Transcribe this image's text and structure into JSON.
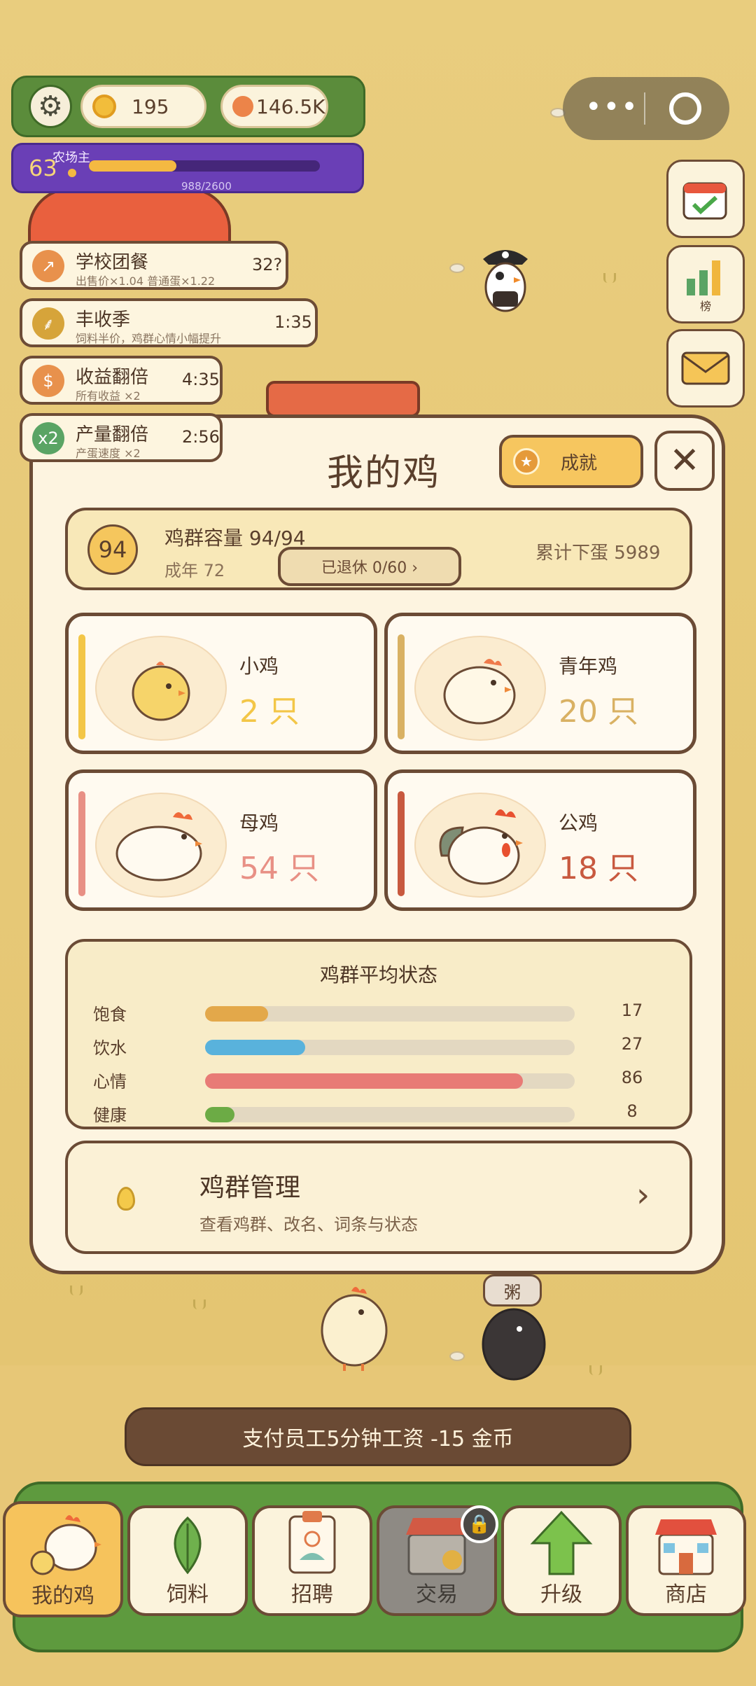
{
  "hud": {
    "coins": "195",
    "eggs": "146.5K",
    "level": "63",
    "level_title": "农场主",
    "xp_text": "988/2600",
    "xp_fraction": 0.38
  },
  "side_buttons": {
    "rank_label": "榜"
  },
  "events": [
    {
      "title": "学校团餐",
      "desc": "出售价×1.04 普通蛋×1.22",
      "time": "32?",
      "icon": "↗",
      "color": "#e8914c"
    },
    {
      "title": "丰收季",
      "desc": "饲料半价，鸡群心情小幅提升",
      "time": "1:35",
      "icon": "wheat-icon",
      "color": "#d6a43a"
    },
    {
      "title": "收益翻倍",
      "desc": "所有收益 ×2",
      "time": "4:35",
      "icon": "$",
      "color": "#e8914c"
    },
    {
      "title": "产量翻倍",
      "desc": "产蛋速度 ×2",
      "time": "2:56",
      "icon": "x2",
      "color": "#5aa464"
    }
  ],
  "modal": {
    "title": "我的鸡",
    "achievements_label": "成就",
    "capacity": {
      "badge": "94",
      "title": "鸡群容量 94/94",
      "adult": "成年 72",
      "retired": "已退休 0/60 ›",
      "total_eggs": "累计下蛋 5989"
    },
    "categories": [
      {
        "name": "小鸡",
        "count": "2 只",
        "color": "#f3c647"
      },
      {
        "name": "青年鸡",
        "count": "20 只",
        "color": "#d9b163"
      },
      {
        "name": "母鸡",
        "count": "54 只",
        "color": "#e89085"
      },
      {
        "name": "公鸡",
        "count": "18 只",
        "color": "#c8593f"
      }
    ],
    "status": {
      "title": "鸡群平均状态",
      "rows": [
        {
          "label": "饱食",
          "value": "17",
          "fraction": 0.17,
          "color": "#e3a84a"
        },
        {
          "label": "饮水",
          "value": "27",
          "fraction": 0.27,
          "color": "#59b2dc"
        },
        {
          "label": "心情",
          "value": "86",
          "fraction": 0.86,
          "color": "#e87b76"
        },
        {
          "label": "健康",
          "value": "8",
          "fraction": 0.08,
          "color": "#6cab45"
        }
      ]
    },
    "manage": {
      "title": "鸡群管理",
      "desc": "查看鸡群、改名、词条与状态"
    }
  },
  "field": {
    "chicken_tag": "粥"
  },
  "toast": "支付员工5分钟工资 -15 金币",
  "nav": [
    {
      "label": "我的鸡",
      "active": true
    },
    {
      "label": "饲料"
    },
    {
      "label": "招聘"
    },
    {
      "label": "交易",
      "locked": true
    },
    {
      "label": "升级"
    },
    {
      "label": "商店"
    }
  ]
}
